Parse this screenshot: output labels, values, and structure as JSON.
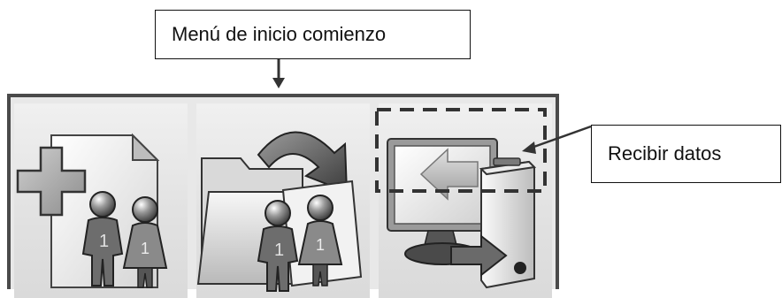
{
  "annotations": {
    "start_menu_label": "Menú de inicio comienzo",
    "receive_data_label": "Recibir datos"
  },
  "menu": {
    "tiles": [
      {
        "icon": "new-patient-icon"
      },
      {
        "icon": "open-folder-patient-icon"
      },
      {
        "icon": "receive-data-icon"
      }
    ]
  },
  "colors": {
    "frame": "#4a4a4a",
    "tile_background": "#e6e6e6",
    "callout_border": "#111111"
  }
}
